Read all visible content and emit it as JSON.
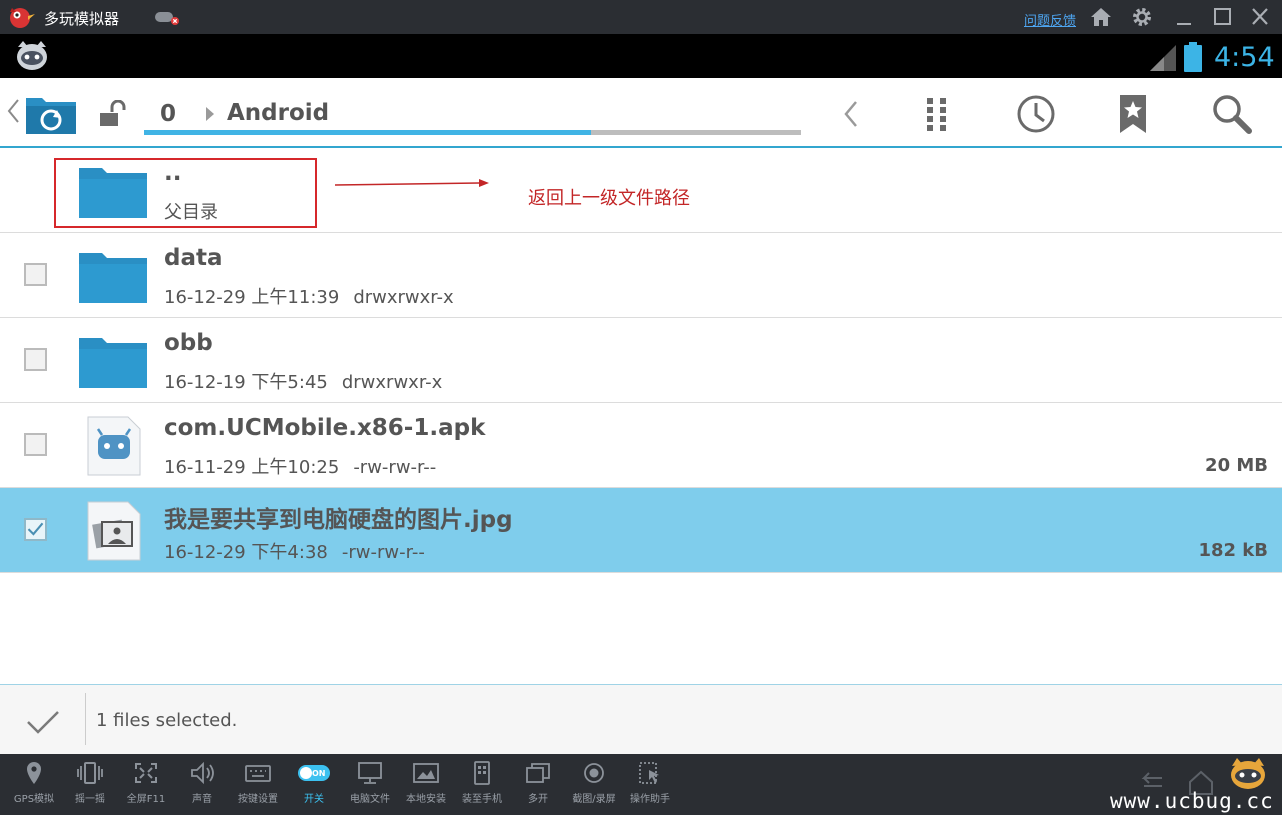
{
  "emulator": {
    "title": "多玩模拟器",
    "feedback_link": "问题反馈",
    "icons": [
      "home-icon",
      "gear-icon",
      "minimize-icon",
      "maximize-icon",
      "close-icon"
    ]
  },
  "statusbar": {
    "time": "4:54"
  },
  "toolbar": {
    "breadcrumb": [
      "0",
      "Android"
    ],
    "path_progress": 0.68,
    "tools": [
      "back-icon",
      "grid-menu-icon",
      "history-icon",
      "bookmark-icon",
      "search-icon"
    ]
  },
  "list": {
    "parent": {
      "name": "..",
      "label": "父目录"
    },
    "annotation": "返回上一级文件路径",
    "items": [
      {
        "name": "data",
        "date": "16-12-29 上午11:39",
        "perm": "drwxrwxr-x",
        "size": "",
        "type": "folder",
        "selected": false
      },
      {
        "name": "obb",
        "date": "16-12-19 下午5:45",
        "perm": "drwxrwxr-x",
        "size": "",
        "type": "folder",
        "selected": false
      },
      {
        "name": "com.UCMobile.x86-1.apk",
        "date": "16-11-29 上午10:25",
        "perm": "-rw-rw-r--",
        "size": "20 MB",
        "type": "apk",
        "selected": false
      },
      {
        "name": "我是要共享到电脑硬盘的图片.jpg",
        "date": "16-12-29 下午4:38",
        "perm": "-rw-rw-r--",
        "size": "182 kB",
        "type": "image",
        "selected": true
      }
    ]
  },
  "selection": {
    "text": "1 files selected."
  },
  "dock": {
    "items": [
      {
        "label": "GPS模拟",
        "icon": "location-pin-icon"
      },
      {
        "label": "摇一摇",
        "icon": "shake-icon"
      },
      {
        "label": "全屏F11",
        "icon": "fullscreen-icon"
      },
      {
        "label": "声音",
        "icon": "volume-icon"
      },
      {
        "label": "按键设置",
        "icon": "keyboard-icon"
      },
      {
        "label": "开关",
        "icon": "toggle-on-icon",
        "toggle_text": "ON"
      },
      {
        "label": "电脑文件",
        "icon": "monitor-icon"
      },
      {
        "label": "本地安装",
        "icon": "install-icon"
      },
      {
        "label": "装至手机",
        "icon": "phone-install-icon"
      },
      {
        "label": "多开",
        "icon": "multi-window-icon"
      },
      {
        "label": "截图/录屏",
        "icon": "record-icon"
      },
      {
        "label": "操作助手",
        "icon": "assistant-icon"
      }
    ],
    "watermark": "www.ucbug.cc"
  },
  "colors": {
    "accent": "#33a6cf",
    "selected_row": "#7fcdec",
    "annotation": "#c32627",
    "clock": "#3cb4e6"
  }
}
